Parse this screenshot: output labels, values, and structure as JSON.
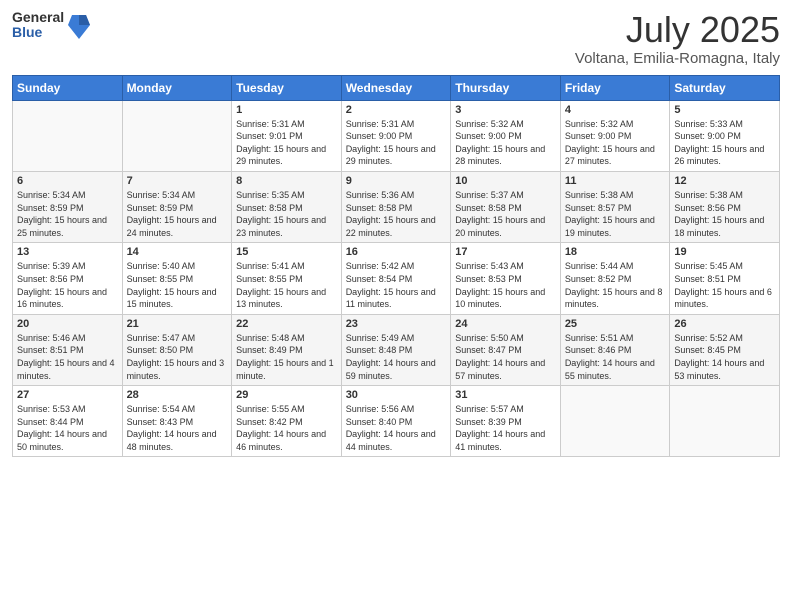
{
  "logo": {
    "general": "General",
    "blue": "Blue"
  },
  "header": {
    "title": "July 2025",
    "subtitle": "Voltana, Emilia-Romagna, Italy"
  },
  "weekdays": [
    "Sunday",
    "Monday",
    "Tuesday",
    "Wednesday",
    "Thursday",
    "Friday",
    "Saturday"
  ],
  "weeks": [
    [
      {
        "day": "",
        "detail": ""
      },
      {
        "day": "",
        "detail": ""
      },
      {
        "day": "1",
        "detail": "Sunrise: 5:31 AM\nSunset: 9:01 PM\nDaylight: 15 hours and 29 minutes."
      },
      {
        "day": "2",
        "detail": "Sunrise: 5:31 AM\nSunset: 9:00 PM\nDaylight: 15 hours and 29 minutes."
      },
      {
        "day": "3",
        "detail": "Sunrise: 5:32 AM\nSunset: 9:00 PM\nDaylight: 15 hours and 28 minutes."
      },
      {
        "day": "4",
        "detail": "Sunrise: 5:32 AM\nSunset: 9:00 PM\nDaylight: 15 hours and 27 minutes."
      },
      {
        "day": "5",
        "detail": "Sunrise: 5:33 AM\nSunset: 9:00 PM\nDaylight: 15 hours and 26 minutes."
      }
    ],
    [
      {
        "day": "6",
        "detail": "Sunrise: 5:34 AM\nSunset: 8:59 PM\nDaylight: 15 hours and 25 minutes."
      },
      {
        "day": "7",
        "detail": "Sunrise: 5:34 AM\nSunset: 8:59 PM\nDaylight: 15 hours and 24 minutes."
      },
      {
        "day": "8",
        "detail": "Sunrise: 5:35 AM\nSunset: 8:58 PM\nDaylight: 15 hours and 23 minutes."
      },
      {
        "day": "9",
        "detail": "Sunrise: 5:36 AM\nSunset: 8:58 PM\nDaylight: 15 hours and 22 minutes."
      },
      {
        "day": "10",
        "detail": "Sunrise: 5:37 AM\nSunset: 8:58 PM\nDaylight: 15 hours and 20 minutes."
      },
      {
        "day": "11",
        "detail": "Sunrise: 5:38 AM\nSunset: 8:57 PM\nDaylight: 15 hours and 19 minutes."
      },
      {
        "day": "12",
        "detail": "Sunrise: 5:38 AM\nSunset: 8:56 PM\nDaylight: 15 hours and 18 minutes."
      }
    ],
    [
      {
        "day": "13",
        "detail": "Sunrise: 5:39 AM\nSunset: 8:56 PM\nDaylight: 15 hours and 16 minutes."
      },
      {
        "day": "14",
        "detail": "Sunrise: 5:40 AM\nSunset: 8:55 PM\nDaylight: 15 hours and 15 minutes."
      },
      {
        "day": "15",
        "detail": "Sunrise: 5:41 AM\nSunset: 8:55 PM\nDaylight: 15 hours and 13 minutes."
      },
      {
        "day": "16",
        "detail": "Sunrise: 5:42 AM\nSunset: 8:54 PM\nDaylight: 15 hours and 11 minutes."
      },
      {
        "day": "17",
        "detail": "Sunrise: 5:43 AM\nSunset: 8:53 PM\nDaylight: 15 hours and 10 minutes."
      },
      {
        "day": "18",
        "detail": "Sunrise: 5:44 AM\nSunset: 8:52 PM\nDaylight: 15 hours and 8 minutes."
      },
      {
        "day": "19",
        "detail": "Sunrise: 5:45 AM\nSunset: 8:51 PM\nDaylight: 15 hours and 6 minutes."
      }
    ],
    [
      {
        "day": "20",
        "detail": "Sunrise: 5:46 AM\nSunset: 8:51 PM\nDaylight: 15 hours and 4 minutes."
      },
      {
        "day": "21",
        "detail": "Sunrise: 5:47 AM\nSunset: 8:50 PM\nDaylight: 15 hours and 3 minutes."
      },
      {
        "day": "22",
        "detail": "Sunrise: 5:48 AM\nSunset: 8:49 PM\nDaylight: 15 hours and 1 minute."
      },
      {
        "day": "23",
        "detail": "Sunrise: 5:49 AM\nSunset: 8:48 PM\nDaylight: 14 hours and 59 minutes."
      },
      {
        "day": "24",
        "detail": "Sunrise: 5:50 AM\nSunset: 8:47 PM\nDaylight: 14 hours and 57 minutes."
      },
      {
        "day": "25",
        "detail": "Sunrise: 5:51 AM\nSunset: 8:46 PM\nDaylight: 14 hours and 55 minutes."
      },
      {
        "day": "26",
        "detail": "Sunrise: 5:52 AM\nSunset: 8:45 PM\nDaylight: 14 hours and 53 minutes."
      }
    ],
    [
      {
        "day": "27",
        "detail": "Sunrise: 5:53 AM\nSunset: 8:44 PM\nDaylight: 14 hours and 50 minutes."
      },
      {
        "day": "28",
        "detail": "Sunrise: 5:54 AM\nSunset: 8:43 PM\nDaylight: 14 hours and 48 minutes."
      },
      {
        "day": "29",
        "detail": "Sunrise: 5:55 AM\nSunset: 8:42 PM\nDaylight: 14 hours and 46 minutes."
      },
      {
        "day": "30",
        "detail": "Sunrise: 5:56 AM\nSunset: 8:40 PM\nDaylight: 14 hours and 44 minutes."
      },
      {
        "day": "31",
        "detail": "Sunrise: 5:57 AM\nSunset: 8:39 PM\nDaylight: 14 hours and 41 minutes."
      },
      {
        "day": "",
        "detail": ""
      },
      {
        "day": "",
        "detail": ""
      }
    ]
  ]
}
